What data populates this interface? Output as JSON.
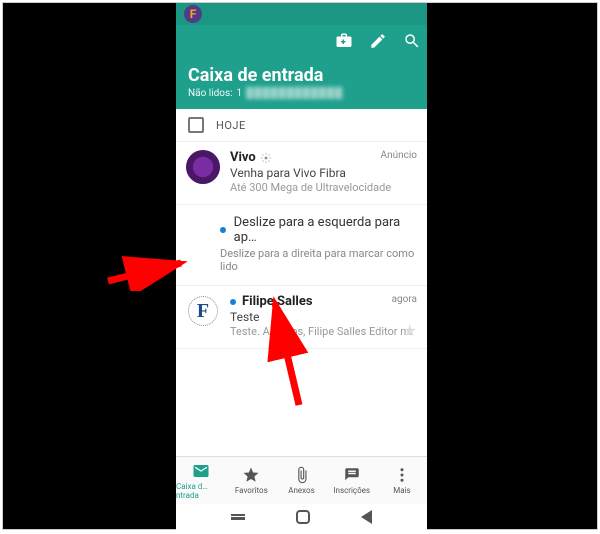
{
  "statusbar": {
    "logo_letter": "F"
  },
  "header": {
    "title": "Caixa de entrada",
    "unread_label": "Não lidos:",
    "unread_count": "1"
  },
  "section": {
    "label": "HOJE"
  },
  "items": [
    {
      "sender": "Vivo",
      "meta": "Anúncio",
      "subject": "Venha para Vivo Fibra",
      "preview": "Até 300 Mega de Ultravelocidade",
      "unread": false
    },
    {
      "sender": "Filipe Salles",
      "meta": "agora",
      "subject": "Teste",
      "preview": "Teste. Abraços, Filipe Salles Editor no…",
      "unread": true,
      "avatar_letter": "F"
    }
  ],
  "tip": {
    "line1": "Deslize para a esquerda para ap…",
    "line2": "Deslize para a direita para marcar como lido"
  },
  "nav": {
    "inbox": "Caixa d…ntrada",
    "favorites": "Favoritos",
    "attachments": "Anexos",
    "subscriptions": "Inscrições",
    "more": "Mais"
  }
}
